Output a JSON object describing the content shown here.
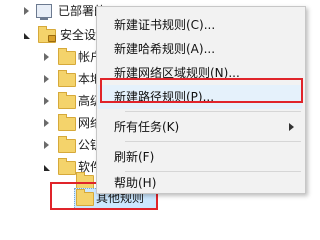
{
  "tree": {
    "items": [
      {
        "label": "已部署的",
        "icon": "computer-icon"
      },
      {
        "label": "安全设置",
        "icon": "lock-folder-icon"
      },
      {
        "label": "帐户",
        "icon": "folder-icon"
      },
      {
        "label": "本地",
        "icon": "folder-icon"
      },
      {
        "label": "高级",
        "icon": "folder-icon"
      },
      {
        "label": "网络",
        "icon": "folder-icon"
      },
      {
        "label": "公钥",
        "icon": "folder-icon"
      },
      {
        "label": "软件",
        "icon": "folder-icon"
      },
      {
        "label": "安",
        "icon": "folder-icon"
      },
      {
        "label": "其他规则",
        "icon": "folder-icon"
      }
    ]
  },
  "context_menu": {
    "items": [
      {
        "label": "新建证书规则(C)..."
      },
      {
        "label": "新建哈希规则(A)..."
      },
      {
        "label": "新建网络区域规则(N)..."
      },
      {
        "label": "新建路径规则(P)..."
      },
      {
        "label": "所有任务(K)"
      },
      {
        "label": "刷新(F)"
      },
      {
        "label": "帮助(H)"
      }
    ]
  },
  "colors": {
    "highlight_border": "#e0242a",
    "menu_hover": "#e5f1fb",
    "selection": "#cce8ff"
  }
}
